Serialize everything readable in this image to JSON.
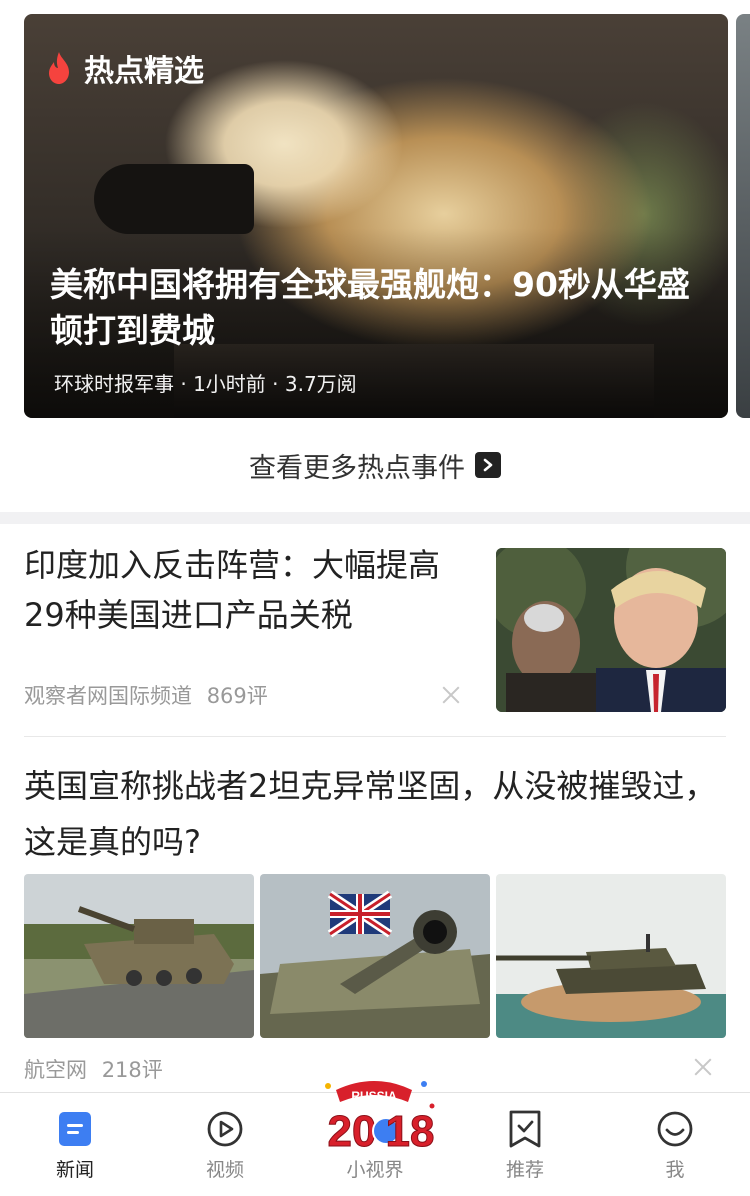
{
  "hot_picks": {
    "label": "热点精选",
    "title": "美称中国将拥有全球最强舰炮：90秒从华盛顿打到费城",
    "meta": "环球时报军事 · 1小时前 · 3.7万阅",
    "more_label": "查看更多热点事件"
  },
  "articles": [
    {
      "title": "印度加入反击阵营：大幅提高29种美国进口产品关税",
      "source": "观察者网国际频道",
      "comments": "869评"
    },
    {
      "title": "英国宣称挑战者2坦克异常坚固，从没被摧毁过，这是真的吗?",
      "source": "航空网",
      "comments": "218评"
    }
  ],
  "bottom_nav": {
    "items": [
      {
        "label": "新闻",
        "icon": "news-icon",
        "active": true
      },
      {
        "label": "视频",
        "icon": "play-icon"
      },
      {
        "label": "小视界",
        "icon": "russia-2018-badge"
      },
      {
        "label": "推荐",
        "icon": "bookmark-icon"
      },
      {
        "label": "我",
        "icon": "smiley-icon"
      }
    ],
    "badge": {
      "top_text": "RUSSIA",
      "year_a": "20",
      "year_b": "18"
    }
  },
  "colors": {
    "accent_blue": "#3d7ef2",
    "flame_red": "#f5433e",
    "badge_red": "#d8202b"
  }
}
